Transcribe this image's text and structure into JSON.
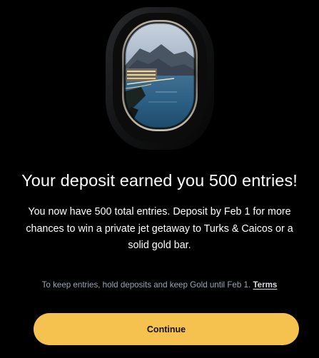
{
  "modal": {
    "hero_alt": "airplane-window-resort-view",
    "headline": "Your deposit earned you 500 entries!",
    "body": "You now have 500 total entries. Deposit by Feb 1 for more chances to win a private jet getaway to Turks & Caicos or a solid gold bar.",
    "disclaimer": {
      "text": "To keep entries, hold deposits and keep Gold until Feb 1.",
      "terms_label": "Terms"
    },
    "continue_label": "Continue"
  },
  "colors": {
    "background": "#000000",
    "button_bg": "#f6c24f",
    "button_text": "#111111",
    "disclaimer_text": "#9aa6b3"
  }
}
